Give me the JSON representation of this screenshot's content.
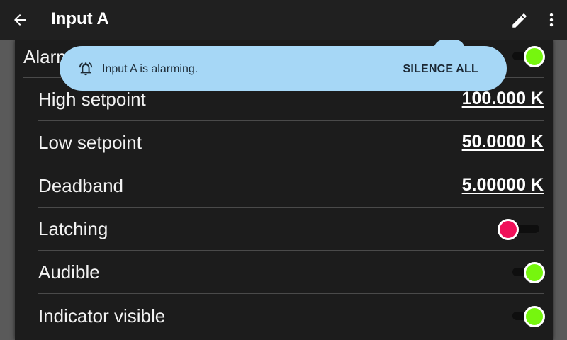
{
  "appbar": {
    "title": "Input A",
    "back_icon": "arrow-back-icon",
    "edit_icon": "pencil-icon",
    "more_icon": "more-vert-icon"
  },
  "snackbar": {
    "icon": "bell-icon",
    "message": "Input A is alarming.",
    "action": "SILENCE ALL"
  },
  "settings": {
    "alarm": {
      "label": "Alarm",
      "enabled": true
    },
    "high_setpoint": {
      "label": "High setpoint",
      "value": "100.000 K"
    },
    "low_setpoint": {
      "label": "Low setpoint",
      "value": "50.0000 K"
    },
    "deadband": {
      "label": "Deadband",
      "value": "5.00000 K"
    },
    "latching": {
      "label": "Latching",
      "enabled": false
    },
    "audible": {
      "label": "Audible",
      "enabled": true
    },
    "indicator_visible": {
      "label": "Indicator visible",
      "enabled": true
    }
  },
  "colors": {
    "switch_on": "#76f60e",
    "switch_off": "#f0115a",
    "snackbar_bg": "#a6d7f6"
  }
}
